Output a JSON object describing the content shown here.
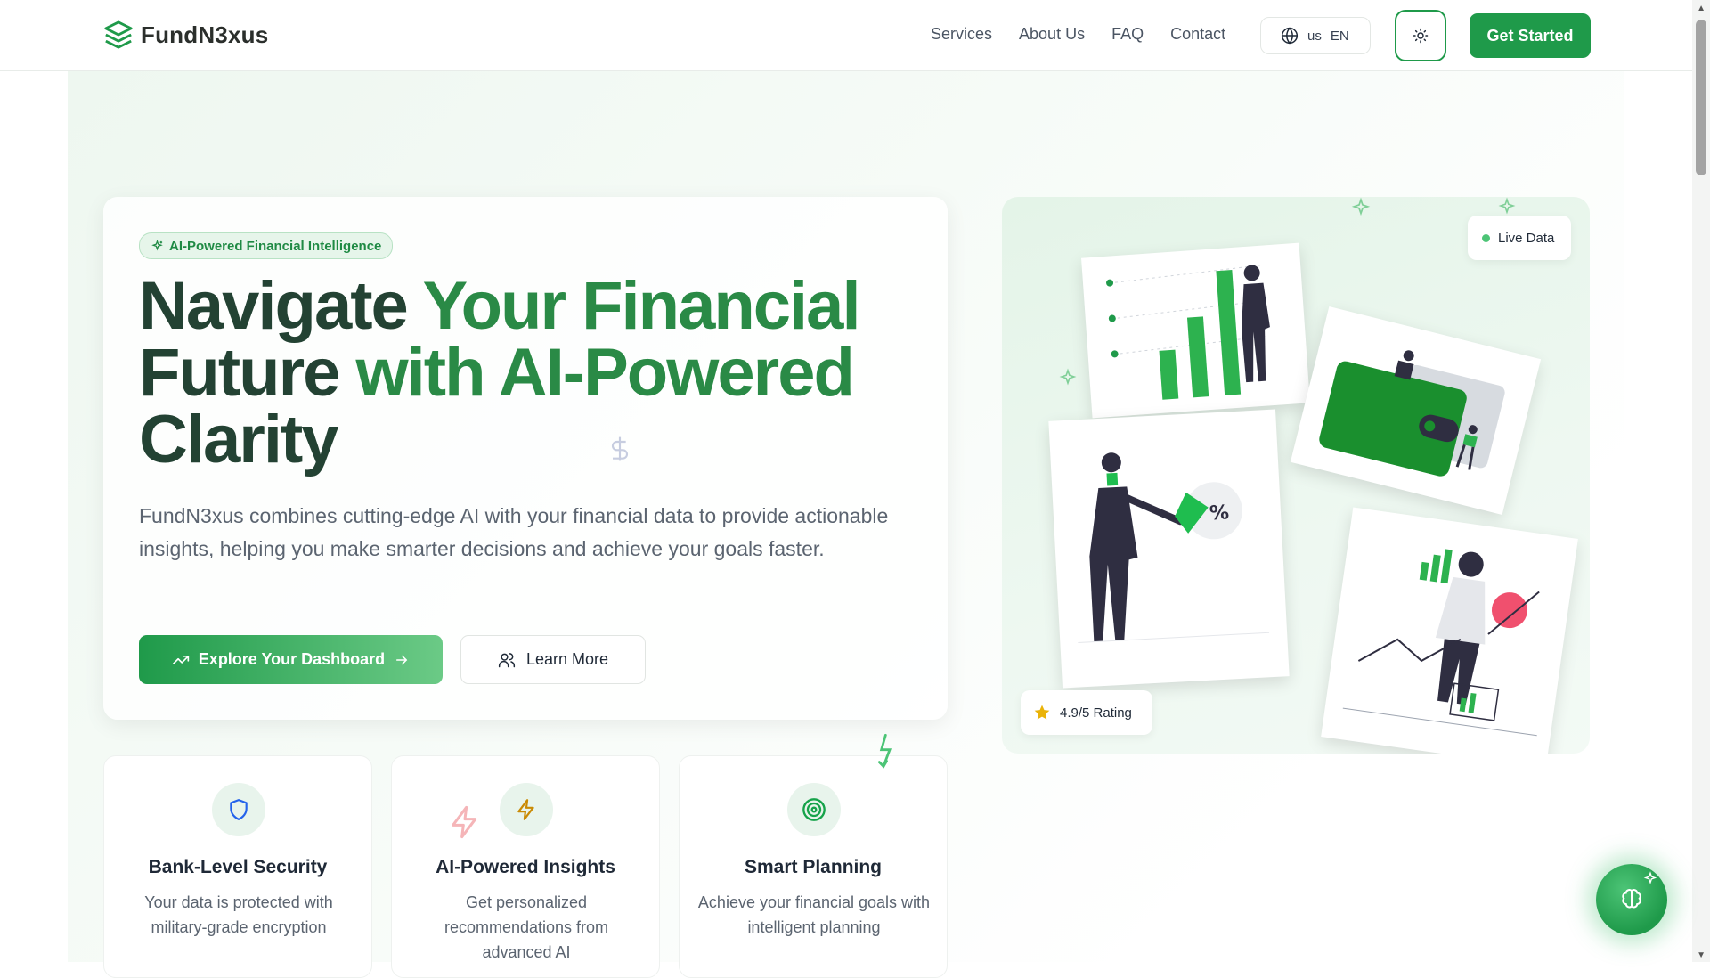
{
  "brand": {
    "name": "FundN3xus",
    "accent": "#1f9a4a",
    "heading_color": "#234233"
  },
  "nav": {
    "links": [
      "Services",
      "About Us",
      "FAQ",
      "Contact"
    ],
    "language": {
      "flag": "us",
      "code": "EN"
    },
    "theme_icon": "sun-icon",
    "cta": "Get Started"
  },
  "hero": {
    "badge": "AI-Powered Financial Intelligence",
    "headline_1": "Navigate ",
    "headline_2": "Your Financial",
    "headline_3": "Future ",
    "headline_4": "with AI-Powered",
    "headline_5": "Clarity",
    "description": "FundN3xus combines cutting-edge AI with your financial data to provide actionable insights, helping you make smarter decisions and achieve your goals faster.",
    "primary_button": "Explore Your Dashboard",
    "secondary_button": "Learn More"
  },
  "features": [
    {
      "title": "Bank-Level Security",
      "text": "Your data is protected with military-grade encryption",
      "icon": "shield-icon",
      "color": "#2563eb"
    },
    {
      "title": "AI-Powered Insights",
      "text": "Get personalized recommendations from advanced AI",
      "icon": "lightning-icon",
      "color": "#ca8a04"
    },
    {
      "title": "Smart Planning",
      "text": "Achieve your financial goals with intelligent planning",
      "icon": "target-icon",
      "color": "#16a34a"
    }
  ],
  "illustration": {
    "live_label": "Live Data",
    "rating_label": "4.9/5 Rating",
    "percent_symbol": "%"
  },
  "assistant": {
    "icon": "brain-icon"
  }
}
